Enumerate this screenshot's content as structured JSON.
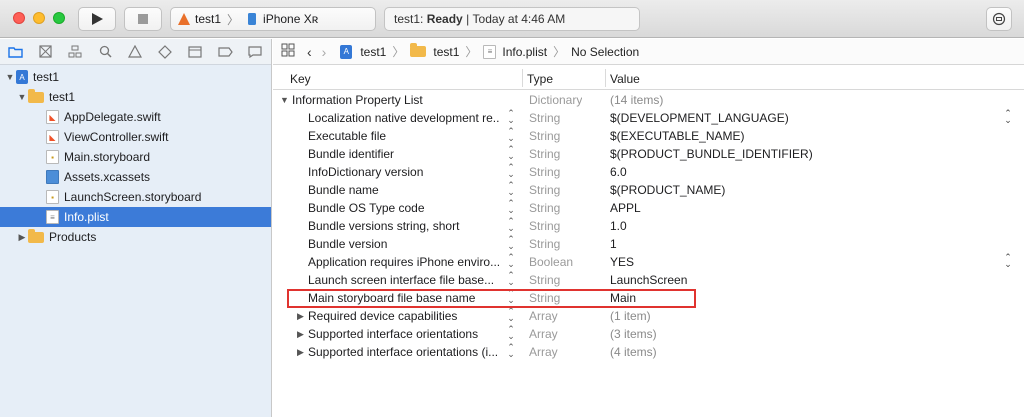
{
  "toolbar": {
    "scheme_target": "test1",
    "device": "iPhone Xʀ",
    "status_project": "test1:",
    "status_state": "Ready",
    "status_divider": "|",
    "status_time": "Today at 4:46 AM"
  },
  "navigator": {
    "tabs": [
      "folder-icon",
      "source-control-icon",
      "hierarchy-icon",
      "search-icon",
      "warning-icon",
      "test-diamond-icon",
      "debug-icon",
      "breakpoint-icon",
      "report-icon"
    ],
    "tree": [
      {
        "label": "test1",
        "kind": "project",
        "disclosure": "▼"
      },
      {
        "label": "test1",
        "kind": "folder",
        "disclosure": "▼"
      },
      {
        "label": "AppDelegate.swift",
        "kind": "swift"
      },
      {
        "label": "ViewController.swift",
        "kind": "swift"
      },
      {
        "label": "Main.storyboard",
        "kind": "storyboard"
      },
      {
        "label": "Assets.xcassets",
        "kind": "assets"
      },
      {
        "label": "LaunchScreen.storyboard",
        "kind": "storyboard"
      },
      {
        "label": "Info.plist",
        "kind": "plist",
        "selected": true
      },
      {
        "label": "Products",
        "kind": "folder",
        "disclosure": "▶"
      }
    ]
  },
  "jumpbar": {
    "crumbs": [
      "test1",
      "test1",
      "Info.plist",
      "No Selection"
    ]
  },
  "table": {
    "headers": {
      "key": "Key",
      "type": "Type",
      "value": "Value"
    },
    "rows": [
      {
        "key": "Information Property List",
        "type": "Dictionary",
        "value": "(14 items)",
        "root": true
      },
      {
        "key": "Localization native development re...",
        "type": "String",
        "value": "$(DEVELOPMENT_LANGUAGE)",
        "popup": true
      },
      {
        "key": "Executable file",
        "type": "String",
        "value": "$(EXECUTABLE_NAME)"
      },
      {
        "key": "Bundle identifier",
        "type": "String",
        "value": "$(PRODUCT_BUNDLE_IDENTIFIER)"
      },
      {
        "key": "InfoDictionary version",
        "type": "String",
        "value": "6.0"
      },
      {
        "key": "Bundle name",
        "type": "String",
        "value": "$(PRODUCT_NAME)"
      },
      {
        "key": "Bundle OS Type code",
        "type": "String",
        "value": "APPL"
      },
      {
        "key": "Bundle versions string, short",
        "type": "String",
        "value": "1.0"
      },
      {
        "key": "Bundle version",
        "type": "String",
        "value": "1"
      },
      {
        "key": "Application requires iPhone enviro...",
        "type": "Boolean",
        "value": "YES",
        "popup": true
      },
      {
        "key": "Launch screen interface file base...",
        "type": "String",
        "value": "LaunchScreen"
      },
      {
        "key": "Main storyboard file base name",
        "type": "String",
        "value": "Main",
        "highlighted": true
      },
      {
        "key": "Required device capabilities",
        "type": "Array",
        "value": "(1 item)",
        "expandable": true
      },
      {
        "key": "Supported interface orientations",
        "type": "Array",
        "value": "(3 items)",
        "expandable": true
      },
      {
        "key": "Supported interface orientations (i...",
        "type": "Array",
        "value": "(4 items)",
        "expandable": true
      }
    ]
  },
  "colors": {
    "highlight": "#e0332f",
    "selection": "#3c7bd8",
    "navigator_bg": "#e6eef7"
  }
}
